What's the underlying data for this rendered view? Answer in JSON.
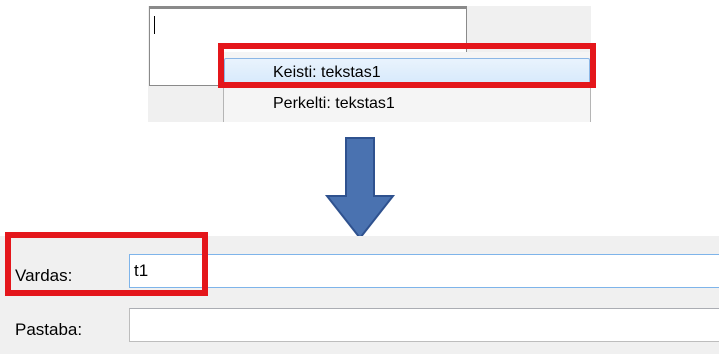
{
  "context_menu": {
    "items": [
      {
        "label": "Keisti: tekstas1",
        "highlighted": true
      },
      {
        "label": "Perkelti: tekstas1",
        "highlighted": false
      }
    ]
  },
  "arrow": {
    "icon": "down-arrow-icon",
    "color": "#4a72b0"
  },
  "form": {
    "vardas": {
      "label": "Vardas:",
      "value": "t1"
    },
    "pastaba": {
      "label": "Pastaba:",
      "value": ""
    }
  },
  "colors": {
    "highlight": "#e4161b",
    "arrow_fill": "#4a72b0",
    "arrow_stroke": "#2f528f",
    "menu_hover": "#d5e8fb",
    "window_bg": "#f0f0f0"
  }
}
